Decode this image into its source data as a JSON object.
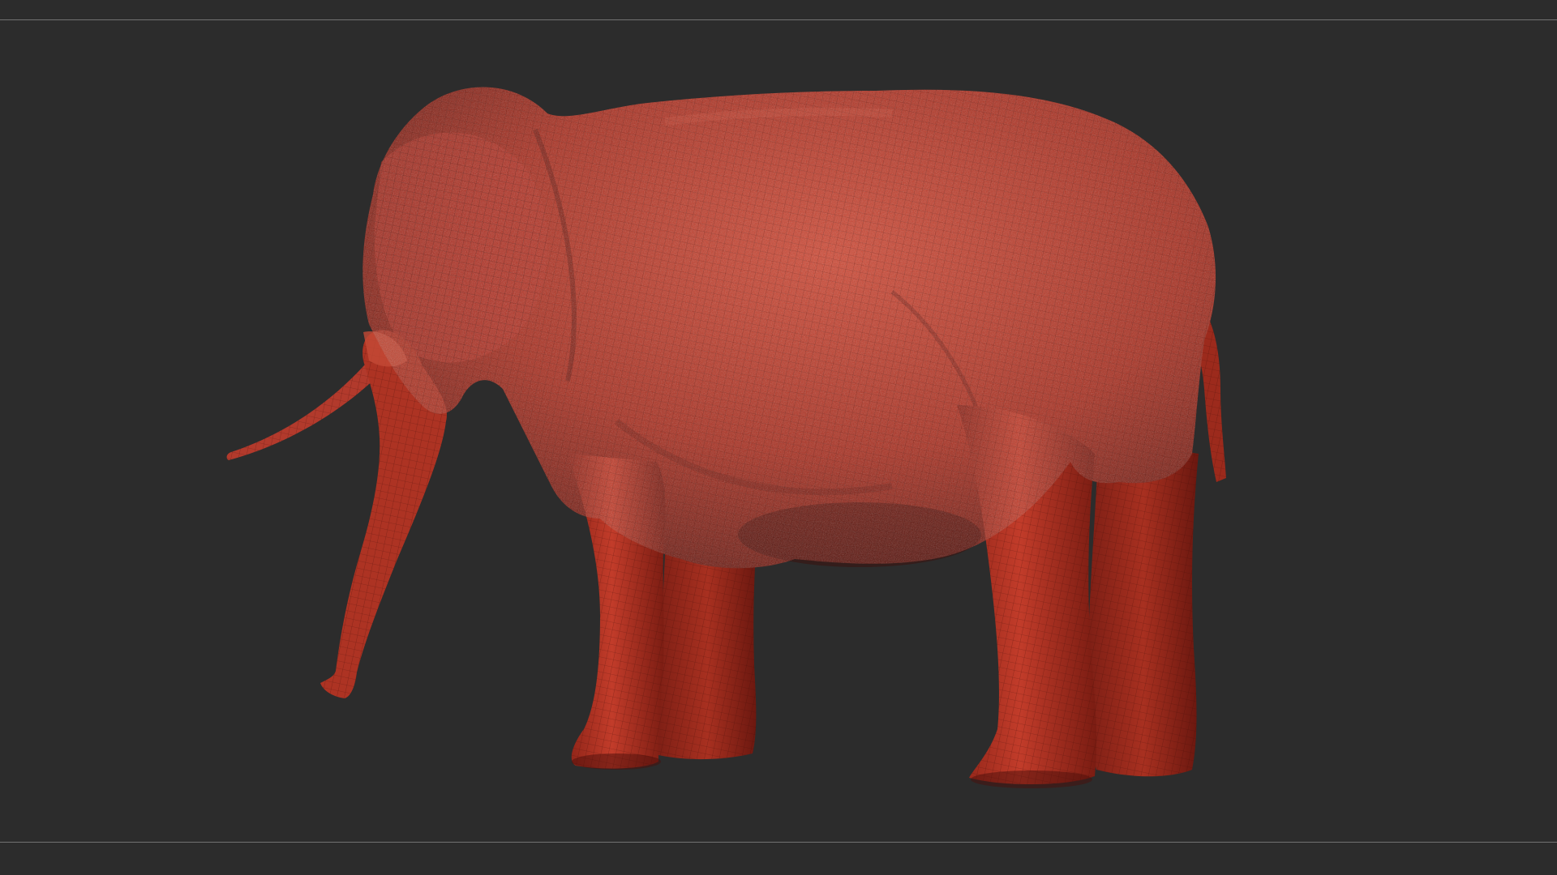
{
  "viewport": {
    "background_color": "#2c2c2c",
    "guide_line_color": "#8a8a8a"
  },
  "model": {
    "subject": "elephant",
    "material_color": "#b03020",
    "highlight_color": "#d4503a",
    "shadow_color": "#5a120c",
    "wireframe_visible": true
  }
}
